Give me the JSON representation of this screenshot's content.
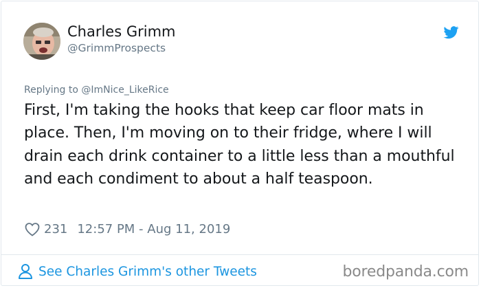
{
  "author": {
    "display_name": "Charles Grimm",
    "handle": "@GrimmProspects"
  },
  "tweet": {
    "replying_to": "Replying to @ImNice_LikeRice",
    "text": "First, I'm taking the hooks that keep car floor mats in place. Then, I'm moving on to their fridge, where I will drain each drink container to a little less than a mouthful and each condiment to about a half teaspoon.",
    "like_count": "231",
    "timestamp": "12:57 PM - Aug 11, 2019"
  },
  "footer": {
    "see_more_label": "See Charles Grimm's other Tweets"
  },
  "watermark": "boredpanda.com",
  "icons": {
    "brand": "twitter-bird-icon",
    "like": "heart-icon",
    "profile": "person-icon"
  },
  "colors": {
    "twitter_blue": "#1da1f2",
    "link_blue": "#1b95e0",
    "secondary_text": "#657786",
    "primary_text": "#14171a",
    "border": "#e1e8ed"
  }
}
